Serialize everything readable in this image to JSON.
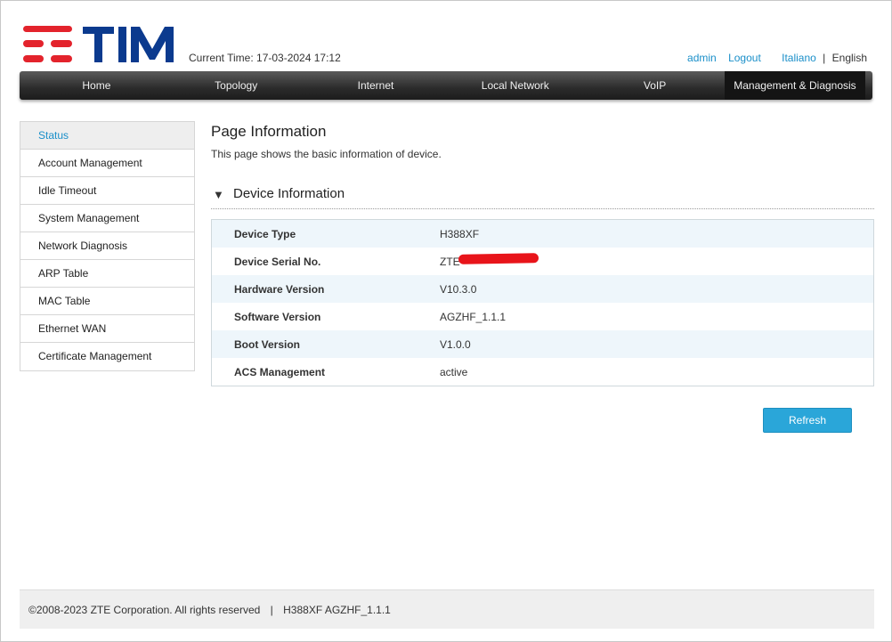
{
  "header": {
    "brand_text": "TIM",
    "current_time_label": "Current Time: 17-03-2024 17:12",
    "links": {
      "admin": "admin",
      "logout": "Logout",
      "italiano": "Italiano",
      "separator": "|",
      "english": "English"
    },
    "brand_colors": {
      "red": "#e3232c",
      "blue": "#0b3a8e"
    }
  },
  "nav": {
    "items": [
      {
        "label": "Home"
      },
      {
        "label": "Topology"
      },
      {
        "label": "Internet"
      },
      {
        "label": "Local Network"
      },
      {
        "label": "VoIP"
      },
      {
        "label": "Management & Diagnosis",
        "active": true
      }
    ]
  },
  "sidebar": {
    "items": [
      {
        "label": "Status",
        "active": true
      },
      {
        "label": "Account Management"
      },
      {
        "label": "Idle Timeout"
      },
      {
        "label": "System Management"
      },
      {
        "label": "Network Diagnosis"
      },
      {
        "label": "ARP Table"
      },
      {
        "label": "MAC Table"
      },
      {
        "label": "Ethernet WAN"
      },
      {
        "label": "Certificate Management"
      }
    ]
  },
  "main": {
    "page_title": "Page Information",
    "page_description": "This page shows the basic information of device.",
    "section": {
      "arrow_icon": "triangle-down-icon",
      "title": "Device Information"
    },
    "device_info": [
      {
        "label": "Device Type",
        "value": "H388XF"
      },
      {
        "label": "Device Serial No.",
        "value": "ZTE",
        "redacted": true
      },
      {
        "label": "Hardware Version",
        "value": "V10.3.0"
      },
      {
        "label": "Software Version",
        "value": "AGZHF_1.1.1"
      },
      {
        "label": "Boot Version",
        "value": "V1.0.0"
      },
      {
        "label": "ACS Management",
        "value": "active"
      }
    ],
    "refresh_label": "Refresh"
  },
  "footer": {
    "copyright": "©2008-2023 ZTE Corporation. All rights reserved",
    "separator": "|",
    "version": "H388XF AGZHF_1.1.1"
  }
}
